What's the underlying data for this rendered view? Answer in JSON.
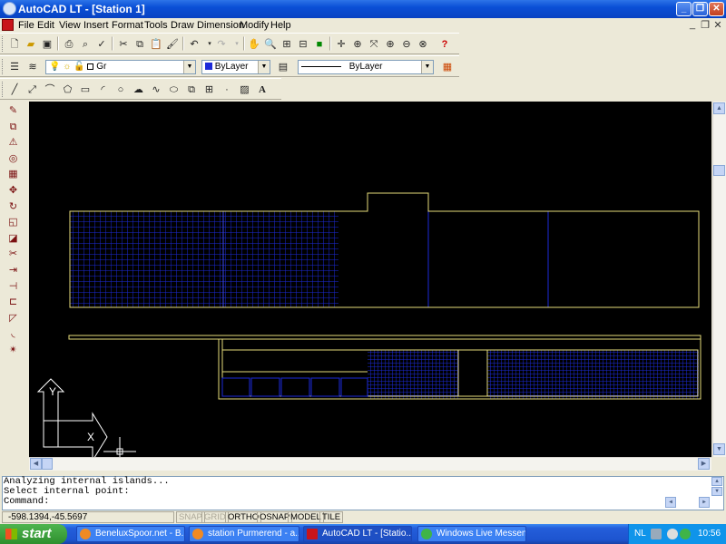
{
  "window": {
    "title": "AutoCAD LT - [Station 1]",
    "controls": [
      "_",
      "❐",
      "✕"
    ],
    "mdi_controls": [
      "_",
      "❐",
      "✕"
    ]
  },
  "menu": [
    "File",
    "Edit",
    "View",
    "Insert",
    "Format",
    "Tools",
    "Draw",
    "Dimension",
    "Modify",
    "Help"
  ],
  "properties_bar": {
    "layer": "Gr",
    "color": "ByLayer",
    "linetype": "ByLayer"
  },
  "drawing_toolbar_icons": [
    "line-icon",
    "construction-line-icon",
    "polyline-icon",
    "polygon-icon",
    "rectangle-icon",
    "arc-icon",
    "circle-icon",
    "revision-cloud-icon",
    "spline-icon",
    "ellipse-icon",
    "insert-block-icon",
    "make-block-icon",
    "point-icon",
    "hatch-icon",
    "multiline-text-icon"
  ],
  "modify_toolbar_icons": [
    "erase-icon",
    "copy-icon",
    "mirror-icon",
    "offset-icon",
    "array-icon",
    "move-icon",
    "rotate-icon",
    "scale-icon",
    "stretch-icon",
    "trim-icon",
    "extend-icon",
    "break-icon",
    "join-icon",
    "chamfer-icon",
    "fillet-icon",
    "explode-icon"
  ],
  "ucs": {
    "y_label": "Y",
    "x_label": "X"
  },
  "command_lines": [
    "Analyzing internal islands...",
    "Select internal point:",
    "Command:"
  ],
  "status": {
    "coordinates": "-598.1394,-45.5697",
    "toggles": [
      {
        "label": "SNAP",
        "on": false
      },
      {
        "label": "GRID",
        "on": false
      },
      {
        "label": "ORTHO",
        "on": true
      },
      {
        "label": "OSNAP",
        "on": true
      },
      {
        "label": "MODEL",
        "on": true
      },
      {
        "label": "TILE",
        "on": true
      }
    ]
  },
  "taskbar": {
    "start_label": "start",
    "tasks": [
      {
        "label": "BeneluxSpoor.net - B...",
        "active": false
      },
      {
        "label": "station Purmerend - a...",
        "active": false
      },
      {
        "label": "AutoCAD LT - [Statio...",
        "active": true
      },
      {
        "label": "Windows Live Messen...",
        "active": false
      }
    ],
    "language": "NL",
    "clock": "10:56"
  },
  "colors": {
    "drawing_bg": "#000000",
    "building_outline": "#e6dc7a",
    "hatch": "#1c2ad8",
    "titlebar": "#0a4fd6"
  }
}
